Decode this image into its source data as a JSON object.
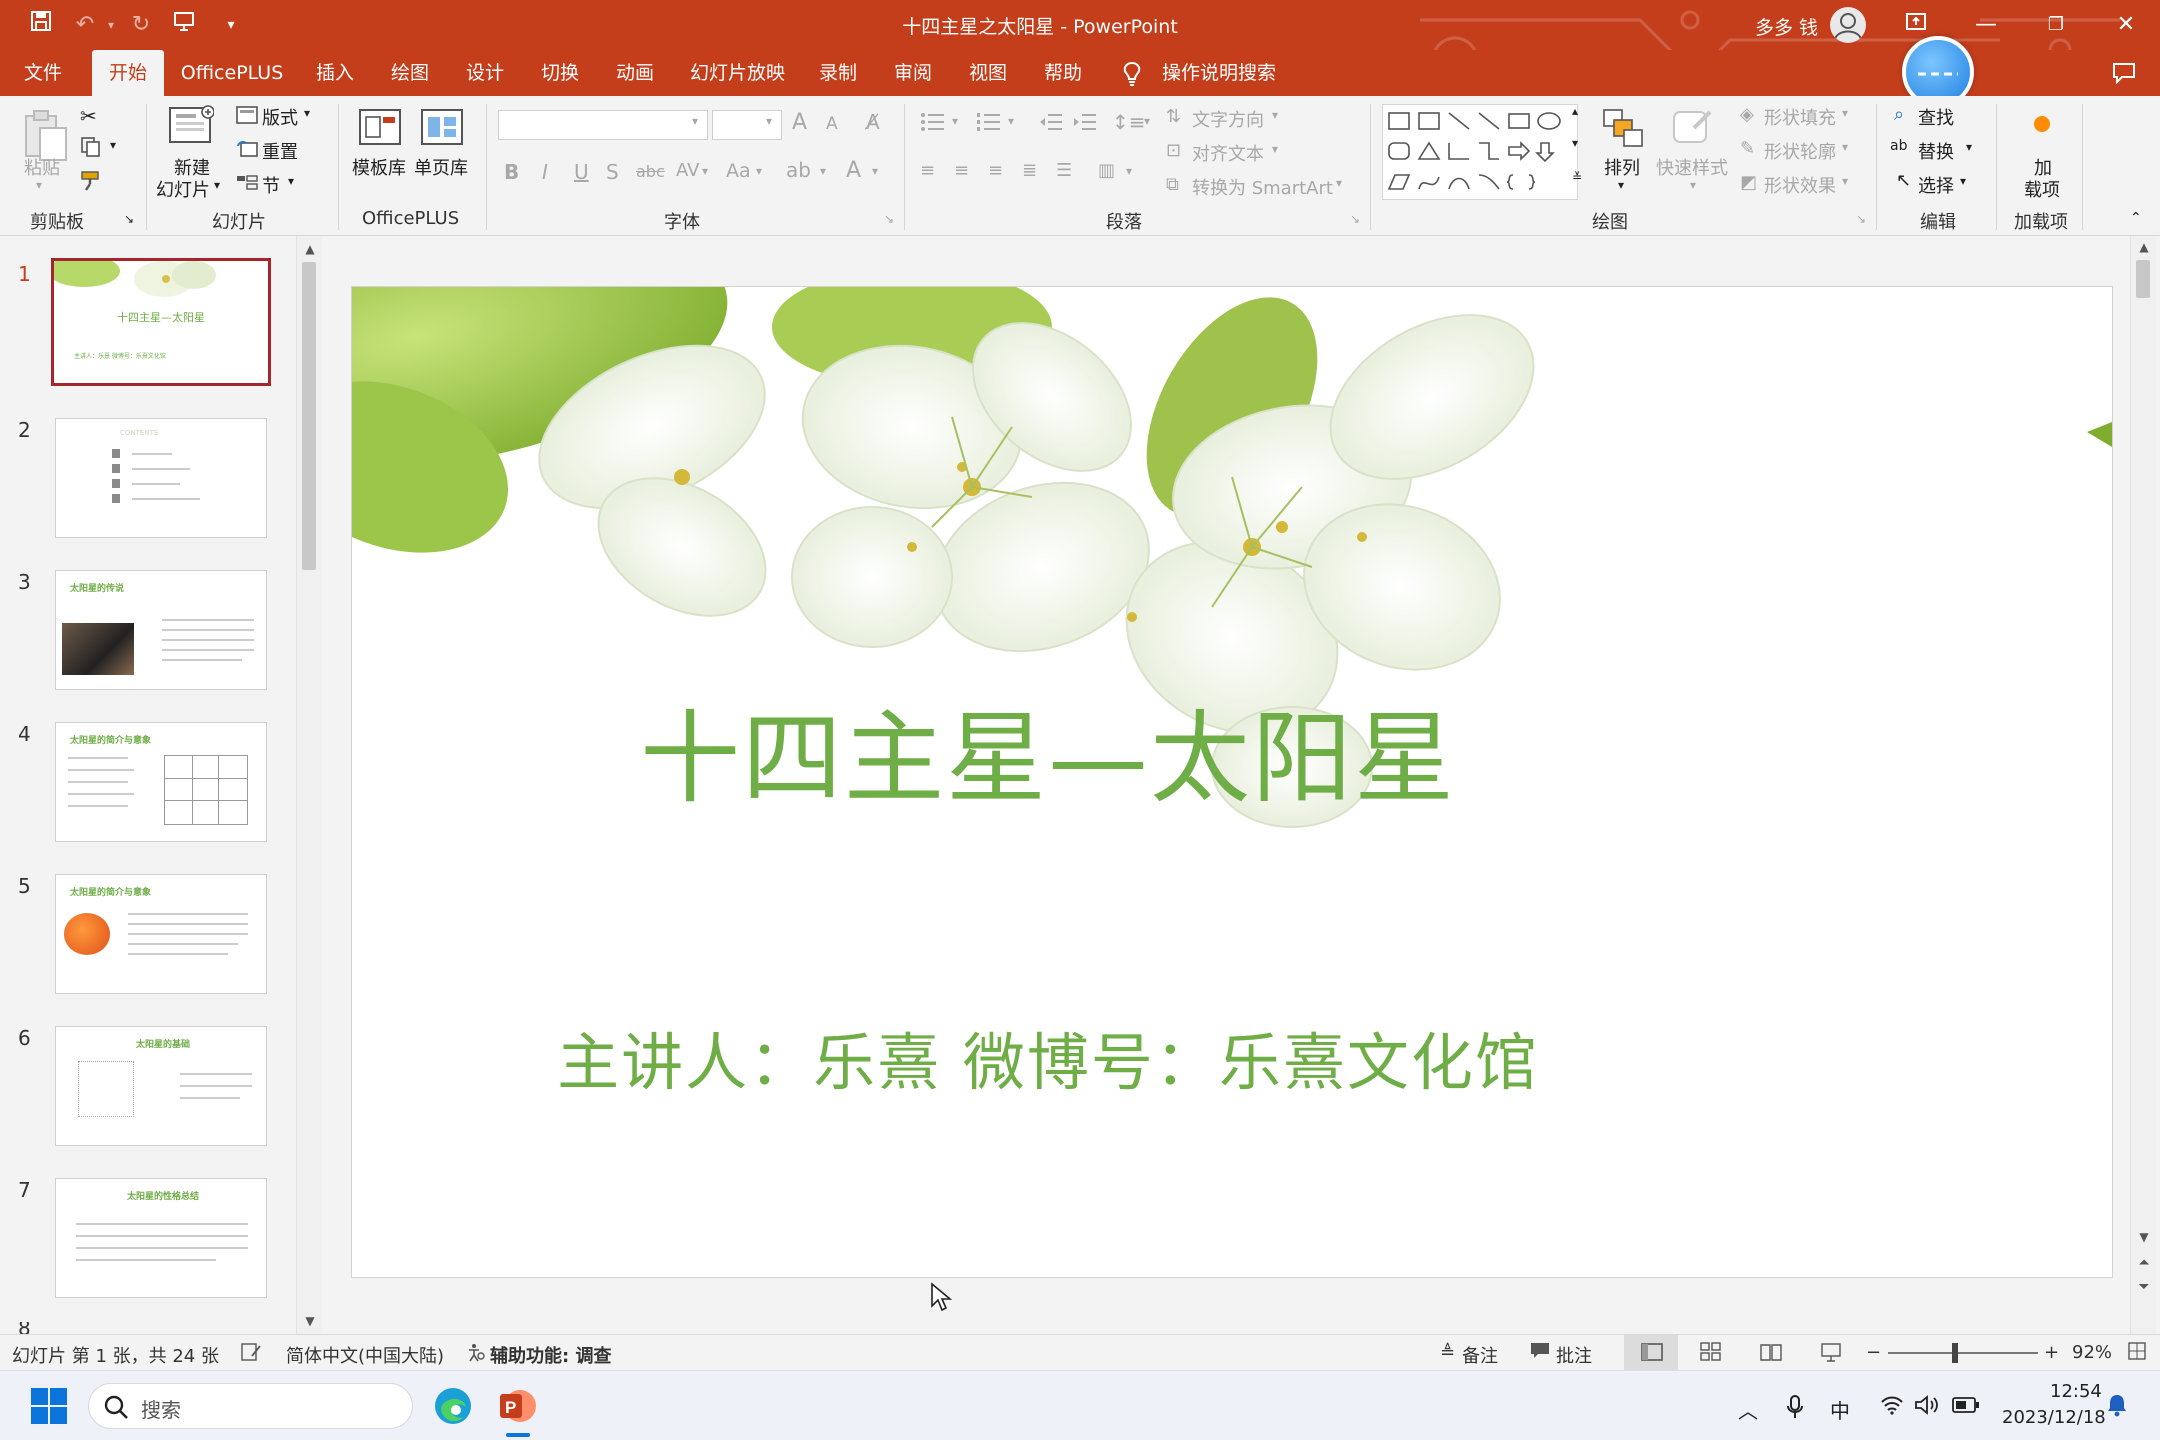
{
  "window": {
    "title": "十四主星之太阳星  -  PowerPoint",
    "user_name": "多多 钱"
  },
  "tabs": [
    "文件",
    "开始",
    "OfficePLUS",
    "插入",
    "绘图",
    "设计",
    "切换",
    "动画",
    "幻灯片放映",
    "录制",
    "审阅",
    "视图",
    "帮助"
  ],
  "active_tab": "开始",
  "tell_me": "操作说明搜索",
  "ribbon": {
    "clipboard": {
      "paste": "粘贴",
      "label": "剪贴板"
    },
    "slides": {
      "new_slide_1": "新建",
      "new_slide_2": "幻灯片",
      "layout": "版式",
      "reset": "重置",
      "section": "节",
      "label": "幻灯片"
    },
    "officeplus": {
      "templates": "模板库",
      "single_page": "单页库",
      "label": "OfficePLUS"
    },
    "font": {
      "label": "字体",
      "bold": "B",
      "italic": "I",
      "underline": "U",
      "shadow": "S",
      "strike": "abc",
      "case": "Aa",
      "grow": "A",
      "shrink": "A"
    },
    "paragraph": {
      "text_direction": "文字方向",
      "align_text": "对齐文本",
      "smartart": "转换为 SmartArt",
      "label": "段落"
    },
    "drawing": {
      "arrange": "排列",
      "quick_styles": "快速样式",
      "shape_fill": "形状填充",
      "shape_outline": "形状轮廓",
      "shape_effects": "形状效果",
      "label": "绘图"
    },
    "editing": {
      "find": "查找",
      "replace": "替换",
      "select": "选择",
      "label": "编辑"
    },
    "addins": {
      "add_1": "加",
      "add_2": "载项",
      "label": "加载项"
    }
  },
  "thumbnails": [
    {
      "num": "1",
      "title": "十四主星—太阳星",
      "sub": "主讲人：乐熹  微博号：乐熹文化馆"
    },
    {
      "num": "2",
      "title": "CONTENTS"
    },
    {
      "num": "3",
      "title": "太阳星的传说"
    },
    {
      "num": "4",
      "title": "太阳星的简介与意象"
    },
    {
      "num": "5",
      "title": "太阳星的简介与意象"
    },
    {
      "num": "6",
      "title": "太阳星的基础"
    },
    {
      "num": "7",
      "title": "太阳星的性格总结"
    }
  ],
  "thumb_partial_num": "8",
  "slide": {
    "title": "十四主星—太阳星",
    "subtitle": "主讲人：乐熹   微博号：乐熹文化馆"
  },
  "status": {
    "slide_info": "幻灯片 第 1 张，共 24 张",
    "language": "简体中文(中国大陆)",
    "accessibility": "辅助功能: 调查",
    "notes": "备注",
    "comments": "批注",
    "zoom": "92%"
  },
  "taskbar": {
    "search_placeholder": "搜索",
    "ime": "中",
    "time": "12:54",
    "date": "2023/12/18"
  },
  "colors": {
    "accent": "#c43e1c",
    "slide_text": "#6fad46",
    "selected_thumb": "#a4262c"
  }
}
